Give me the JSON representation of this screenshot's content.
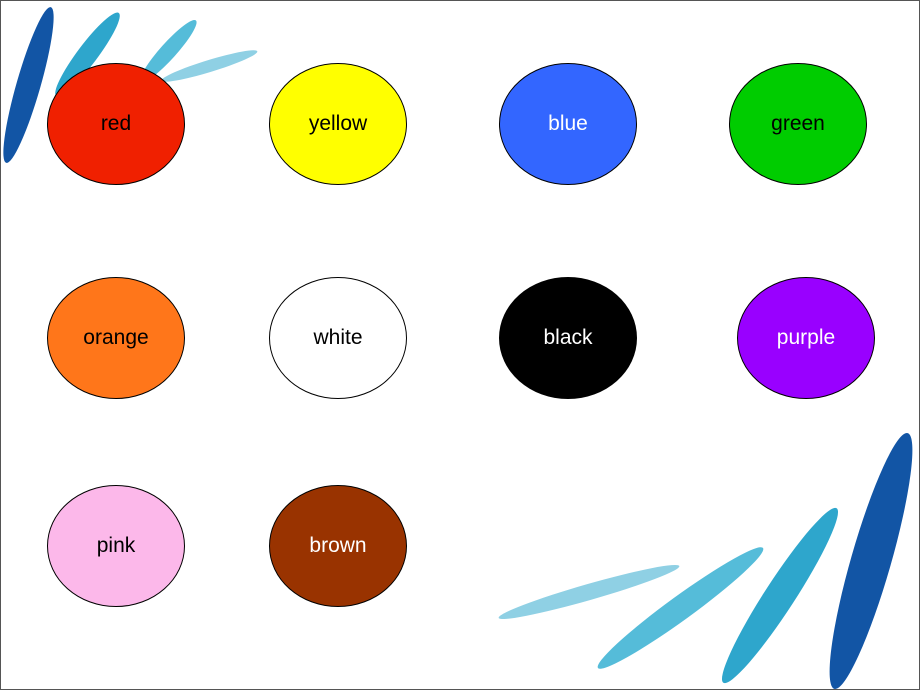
{
  "colors": [
    {
      "label": "red",
      "fill": "#f02000",
      "text": "#000000"
    },
    {
      "label": "yellow",
      "fill": "#ffff00",
      "text": "#000000"
    },
    {
      "label": "blue",
      "fill": "#3366ff",
      "text": "#ffffff"
    },
    {
      "label": "green",
      "fill": "#00cc00",
      "text": "#000000"
    },
    {
      "label": "orange",
      "fill": "#ff761a",
      "text": "#000000"
    },
    {
      "label": "white",
      "fill": "#ffffff",
      "text": "#000000"
    },
    {
      "label": "black",
      "fill": "#000000",
      "text": "#ffffff"
    },
    {
      "label": "purple",
      "fill": "#9900ff",
      "text": "#ffffff"
    },
    {
      "label": "pink",
      "fill": "#fcb8ea",
      "text": "#000000"
    },
    {
      "label": "brown",
      "fill": "#993300",
      "text": "#ffffff"
    }
  ],
  "decoration_colors": [
    "#1255a5",
    "#2ea6cc",
    "#55bcd9",
    "#8fd0e4"
  ]
}
